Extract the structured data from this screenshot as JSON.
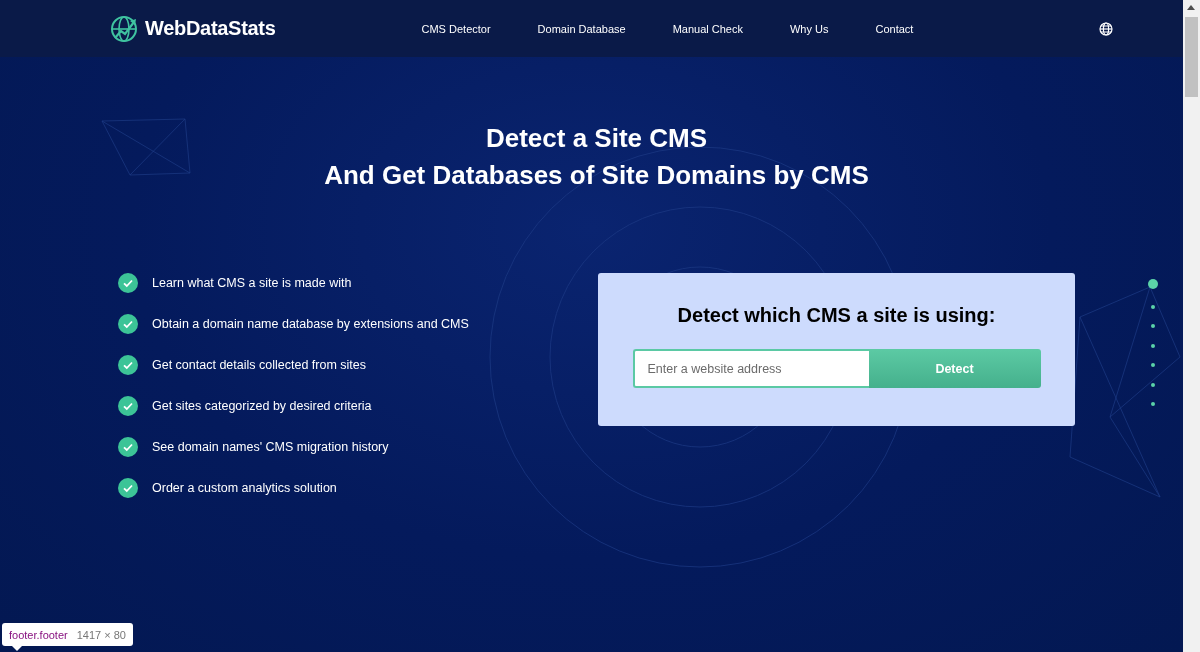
{
  "header": {
    "logo": "WebDataStats",
    "nav": [
      {
        "label": "CMS Detector"
      },
      {
        "label": "Domain Database"
      },
      {
        "label": "Manual Check"
      },
      {
        "label": "Why Us"
      },
      {
        "label": "Contact"
      }
    ]
  },
  "hero": {
    "title_lines": [
      "Detect a Site CMS",
      "And Get Databases of Site Domains by CMS"
    ]
  },
  "features": [
    {
      "text": "Learn what CMS a site is made with"
    },
    {
      "text": "Obtain a domain name database by extensions and CMS"
    },
    {
      "text": "Get contact details collected from sites"
    },
    {
      "text": "Get sites categorized by desired criteria"
    },
    {
      "text": "See domain names' CMS migration history"
    },
    {
      "text": "Order a custom analytics solution"
    }
  ],
  "detect_card": {
    "heading": "Detect which CMS a site is using:",
    "input": {
      "placeholder": "Enter a website address"
    },
    "button": "Detect"
  },
  "slider_dots": [
    {
      "selected": true
    },
    {
      "selected": false
    },
    {
      "selected": false
    },
    {
      "selected": false
    },
    {
      "selected": false
    },
    {
      "selected": false
    },
    {
      "selected": false
    }
  ],
  "devtools_tooltip": {
    "selector": "footer.footer",
    "size": "1417 × 80"
  }
}
